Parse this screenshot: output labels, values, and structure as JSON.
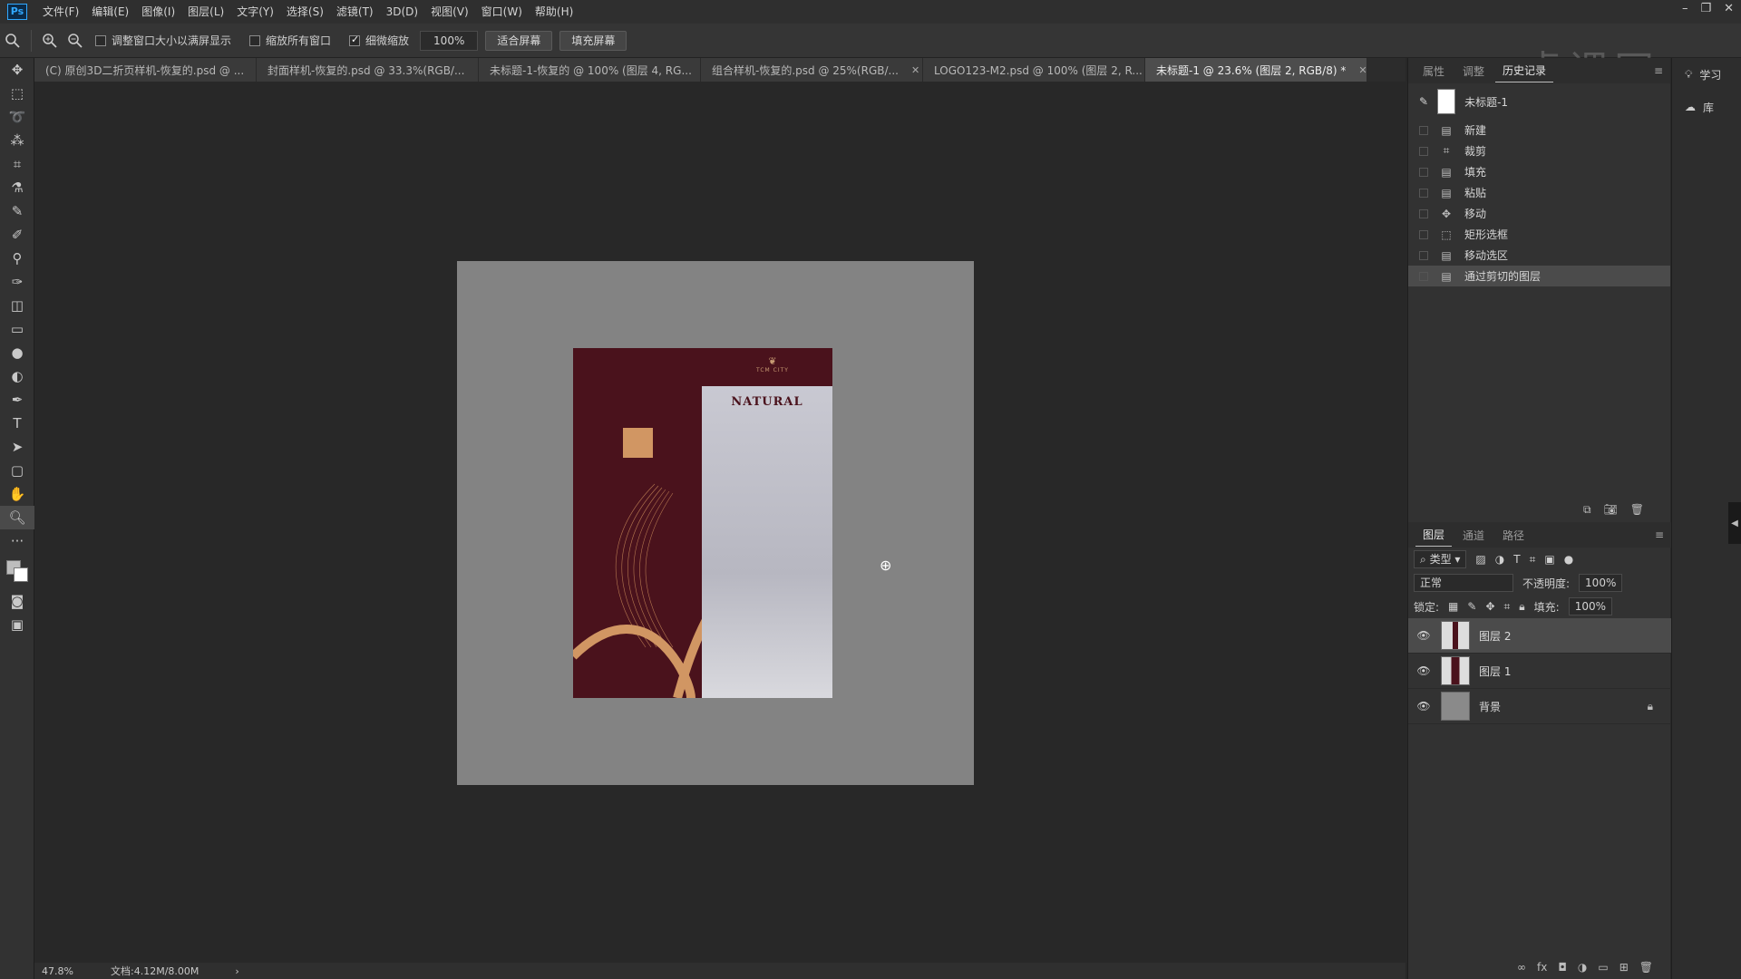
{
  "app": {
    "logo": "Ps"
  },
  "menu": [
    "文件(F)",
    "编辑(E)",
    "图像(I)",
    "图层(L)",
    "文字(Y)",
    "选择(S)",
    "滤镜(T)",
    "3D(D)",
    "视图(V)",
    "窗口(W)",
    "帮助(H)"
  ],
  "options": {
    "resize_windows": "调整窗口大小以满屏显示",
    "zoom_all": "缩放所有窗口",
    "scrubby": "细微缩放",
    "zoom_value": "100%",
    "fit_screen": "适合屏幕",
    "fill_screen": "填充屏幕"
  },
  "watermark": "虎课网",
  "tabs": [
    "(C) 原创3D二折页样机-恢复的.psd @ ...",
    "封面样机-恢复的.psd @ 33.3%(RGB/...",
    "未标题-1-恢复的 @ 100% (图层 4, RG...",
    "组合样机-恢复的.psd @ 25%(RGB/...",
    "LOGO123-M2.psd @ 100% (图层 2, R...",
    "未标题-1 @ 23.6% (图层 2, RGB/8) *"
  ],
  "poster": {
    "logo": "TCM CITY",
    "title": "NATURAL"
  },
  "status": {
    "zoom": "47.8%",
    "doc": "文档:4.12M/8.00M"
  },
  "history_panel": {
    "tabs": [
      "属性",
      "调整",
      "历史记录"
    ],
    "snapshot": "未标题-1",
    "items": [
      {
        "icon": "document-icon",
        "label": "新建"
      },
      {
        "icon": "crop-icon",
        "label": "裁剪"
      },
      {
        "icon": "document-icon",
        "label": "填充"
      },
      {
        "icon": "document-icon",
        "label": "粘贴"
      },
      {
        "icon": "move-icon",
        "label": "移动"
      },
      {
        "icon": "marquee-icon",
        "label": "矩形选框"
      },
      {
        "icon": "document-icon",
        "label": "移动选区"
      },
      {
        "icon": "document-icon",
        "label": "通过剪切的图层"
      }
    ]
  },
  "layers_panel": {
    "tabs": [
      "图层",
      "通道",
      "路径"
    ],
    "filter": "类型",
    "blend_mode": "正常",
    "opacity_label": "不透明度:",
    "opacity": "100%",
    "lock_label": "锁定:",
    "fill_label": "填充:",
    "fill": "100%",
    "layers": [
      {
        "name": "图层 2"
      },
      {
        "name": "图层 1"
      },
      {
        "name": "背景"
      }
    ]
  },
  "right_strip": {
    "learn": "学习",
    "library": "库"
  }
}
